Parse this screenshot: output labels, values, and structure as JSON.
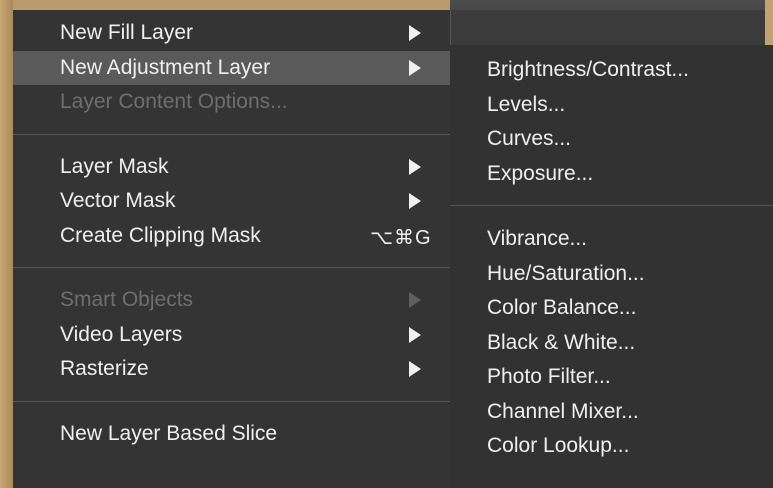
{
  "main_menu": {
    "items": [
      {
        "label": "New Fill Layer"
      },
      {
        "label": "New Adjustment Layer"
      },
      {
        "label": "Layer Content Options..."
      },
      {
        "label": "Layer Mask"
      },
      {
        "label": "Vector Mask"
      },
      {
        "label": "Create Clipping Mask",
        "shortcut": "⌥⌘G"
      },
      {
        "label": "Smart Objects"
      },
      {
        "label": "Video Layers"
      },
      {
        "label": "Rasterize"
      },
      {
        "label": "New Layer Based Slice"
      }
    ]
  },
  "submenu": {
    "items": [
      {
        "label": "Brightness/Contrast..."
      },
      {
        "label": "Levels..."
      },
      {
        "label": "Curves..."
      },
      {
        "label": "Exposure..."
      },
      {
        "label": "Vibrance..."
      },
      {
        "label": "Hue/Saturation..."
      },
      {
        "label": "Color Balance..."
      },
      {
        "label": "Black & White..."
      },
      {
        "label": "Photo Filter..."
      },
      {
        "label": "Channel Mixer..."
      },
      {
        "label": "Color Lookup..."
      }
    ]
  },
  "colors": {
    "menu_background": "#343434",
    "highlight": "#5a5a5a",
    "text": "#efefef",
    "disabled_text": "#6e6e6e"
  }
}
